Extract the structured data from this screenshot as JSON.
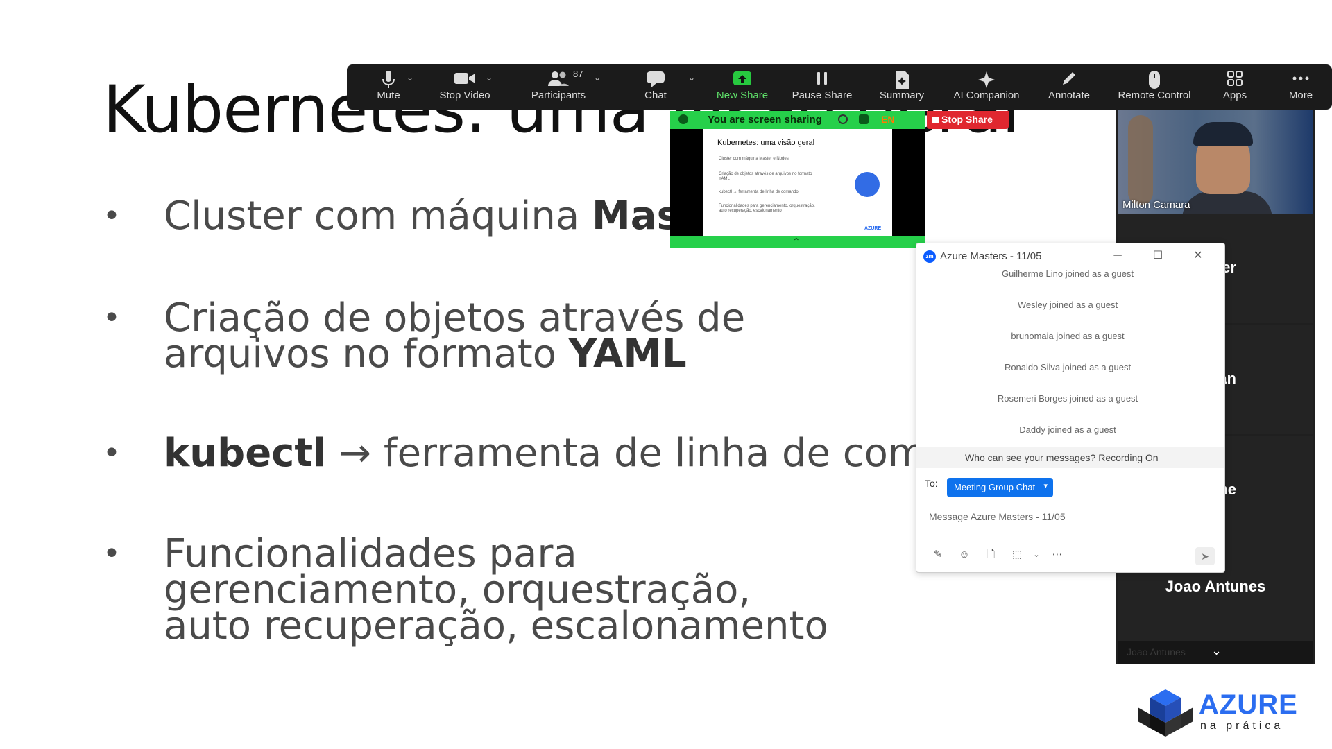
{
  "slide": {
    "title": "Kubernetes: uma visão geral",
    "bullets": [
      {
        "pre": "Cluster com máquina ",
        "bold": "Master",
        "post": ""
      },
      {
        "pre": "Criação de objetos através de arquivos no formato ",
        "bold": "YAML",
        "post": ""
      },
      {
        "pre": "",
        "bold": "kubectl",
        "post": " → ferramenta de linha de comando"
      },
      {
        "pre": "Funcionalidades para gerenciamento, orquestração, auto recuperação, escalonamento",
        "bold": "",
        "post": ""
      }
    ],
    "bullet_glyph": "•",
    "logo_word": "AZURE",
    "logo_sub": "na prática"
  },
  "toolbar": {
    "mute": "Mute",
    "stop_video": "Stop Video",
    "participants": "Participants",
    "participants_count": "87",
    "chat": "Chat",
    "new_share": "New Share",
    "pause_share": "Pause Share",
    "summary": "Summary",
    "ai_companion": "AI Companion",
    "annotate": "Annotate",
    "remote_control": "Remote Control",
    "apps": "Apps",
    "more": "More"
  },
  "share": {
    "banner": "You are screen sharing",
    "lang": "EN",
    "stop": "Stop Share",
    "preview_title": "Kubernetes: uma visão geral",
    "preview_bullets": [
      "Cluster com máquina Master e Nodes",
      "Criação de objetos através de arquivos no formato YAML",
      "kubectl → ferramenta de linha de comando",
      "Funcionalidades para gerenciamento, orquestração, auto recuperação, escalonamento"
    ],
    "preview_logo": "AZURE"
  },
  "participants_panel": {
    "video_name": "Milton Camara",
    "tiles": [
      "er",
      "han",
      "me",
      "Joao Antunes"
    ],
    "bottom_ghost": "Joao Antunes"
  },
  "chat": {
    "title": "Azure Masters - 11/05",
    "messages": [
      "Guilherme Lino joined as a guest",
      "Wesley joined as a guest",
      "brunomaia joined as a guest",
      "Ronaldo Silva joined as a guest",
      "Rosemeri Borges joined as a guest",
      "Daddy joined as a guest"
    ],
    "recording": "Who can see your messages? Recording On",
    "to_label": "To:",
    "to_value": "Meeting Group Chat",
    "placeholder": "Message Azure Masters - 11/05"
  },
  "colors": {
    "zoom_green": "#26d04a",
    "stop_red": "#e0272f",
    "chat_blue": "#0e72ed",
    "azure_blue": "#2b6df0"
  }
}
